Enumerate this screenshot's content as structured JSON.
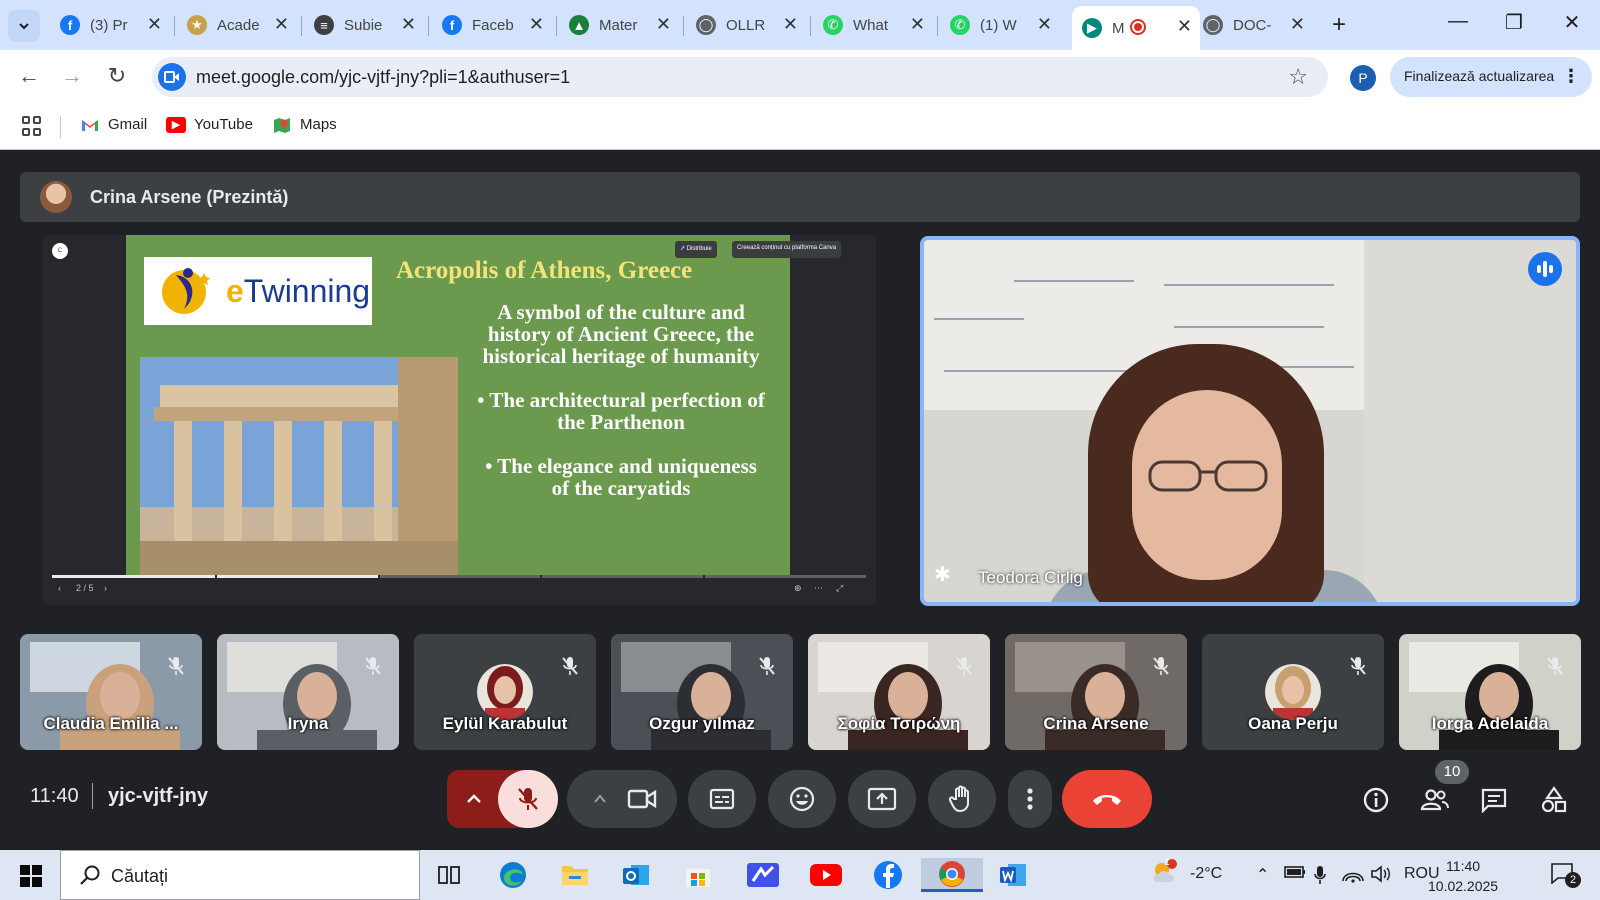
{
  "browser": {
    "tabs": [
      {
        "title": "(3) Pr",
        "icon": "facebook-icon",
        "color": "#1877f2"
      },
      {
        "title": "Acade",
        "icon": "crest-icon",
        "color": "#c8a24a"
      },
      {
        "title": "Subie",
        "icon": "doc-icon",
        "color": "#3c4043"
      },
      {
        "title": "Faceb",
        "icon": "facebook-icon",
        "color": "#1877f2"
      },
      {
        "title": "Mater",
        "icon": "classroom-icon",
        "color": "#188038"
      },
      {
        "title": "OLLR",
        "icon": "globe-icon",
        "color": "#5f6368"
      },
      {
        "title": "What",
        "icon": "whatsapp-icon",
        "color": "#25d366"
      },
      {
        "title": "(1) W",
        "icon": "whatsapp-icon",
        "color": "#25d366"
      },
      {
        "title": "M",
        "icon": "meet-icon",
        "color": "#00897b",
        "active": true
      },
      {
        "title": "DOC-",
        "icon": "globe-icon",
        "color": "#5f6368"
      }
    ],
    "url": "meet.google.com/yjc-vjtf-jny?pli=1&authuser=1",
    "profile_initial": "P",
    "update_label": "Finalizează actualizarea",
    "bookmarks": [
      {
        "label": "Gmail",
        "icon": "gmail-icon"
      },
      {
        "label": "YouTube",
        "icon": "youtube-icon"
      },
      {
        "label": "Maps",
        "icon": "maps-icon"
      }
    ]
  },
  "meet": {
    "presenter_label": "Crina Arsene (Prezintă)",
    "slide": {
      "logo_text": "eTwinning",
      "title": "Acropolis of Athens, Greece",
      "intro": "A symbol of the culture and history of Ancient Greece, the historical heritage of humanity",
      "bullets": [
        "• The architectural perfection of the Parthenon",
        "• The elegance and uniqueness of the caryatids"
      ],
      "share_label": "Distribuie",
      "canva_label": "Creează conținut cu platforma Canva",
      "page_indicator": "2 / 5",
      "progress": 0.4
    },
    "speaker": {
      "name": "Teodora Cirlig"
    },
    "participants": [
      {
        "name": "Claudia Emilia ...",
        "type": "video"
      },
      {
        "name": "Iryna",
        "type": "video"
      },
      {
        "name": "Eylül Karabulut",
        "type": "avatar"
      },
      {
        "name": "Ozgur yılmaz",
        "type": "video"
      },
      {
        "name": "Σοφία Τσιρώνη",
        "type": "video"
      },
      {
        "name": "Crina Arsene",
        "type": "video"
      },
      {
        "name": "Oana Perju",
        "type": "avatar"
      },
      {
        "name": "Iorga Adelaida",
        "type": "video"
      }
    ],
    "time": "11:40",
    "meeting_code": "yjc-vjtf-jny",
    "participant_count": "10"
  },
  "taskbar": {
    "search_placeholder": "Căutați",
    "weather": "-2°C",
    "weather_badge": "1",
    "language": "ROU",
    "clock_time": "11:40",
    "clock_date": "10.02.2025",
    "notification_count": "2"
  }
}
